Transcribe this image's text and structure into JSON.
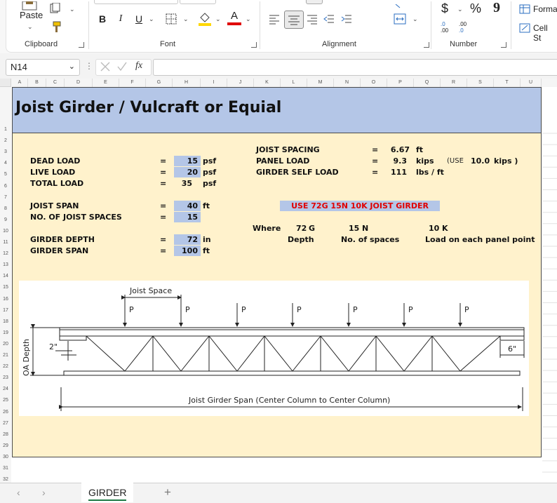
{
  "ribbon": {
    "clipboard": {
      "paste_label": "Paste",
      "group_label": "Clipboard"
    },
    "font": {
      "bold": "B",
      "italic": "I",
      "underline": "U",
      "font_color_letter": "A",
      "group_label": "Font",
      "font_color": "#e00000",
      "highlight_color": "#ffd700"
    },
    "alignment": {
      "group_label": "Alignment"
    },
    "number": {
      "currency": "$",
      "percent": "%",
      "comma": "9",
      "inc_decimal": ".0",
      "inc_decimal_b": ".00",
      "dec_decimal": ".00",
      "dec_decimal_b": ".0",
      "group_label": "Number"
    },
    "styles": {
      "format_label": "Forma",
      "cell_styles_label": "Cell St"
    }
  },
  "formula_bar": {
    "name_box": "N14",
    "fx": "fx",
    "formula": ""
  },
  "columns": [
    "A",
    "B",
    "C",
    "D",
    "E",
    "F",
    "G",
    "H",
    "I",
    "J",
    "K",
    "L",
    "M",
    "N",
    "O",
    "P",
    "Q",
    "R",
    "S",
    "T",
    "U"
  ],
  "rows": [
    "1",
    "2",
    "3",
    "4",
    "5",
    "6",
    "7",
    "8",
    "9",
    "10",
    "11",
    "12",
    "13",
    "14",
    "15",
    "16",
    "17",
    "18",
    "19",
    "20",
    "21",
    "22",
    "23",
    "24",
    "25",
    "26",
    "27",
    "28",
    "29",
    "30",
    "31",
    "32"
  ],
  "sheet": {
    "title": "Joist Girder / Vulcraft or Equial",
    "left": [
      {
        "label": "DEAD LOAD",
        "eq": "=",
        "value": "15",
        "unit": "psf",
        "input": true
      },
      {
        "label": "LIVE LOAD",
        "eq": "=",
        "value": "20",
        "unit": "psf",
        "input": true
      },
      {
        "label": "TOTAL LOAD",
        "eq": "=",
        "value": "35",
        "unit": "psf",
        "input": false
      },
      {
        "label": "JOIST SPAN",
        "eq": "=",
        "value": "40",
        "unit": "ft",
        "input": true
      },
      {
        "label": "NO. OF JOIST SPACES",
        "eq": "=",
        "value": "15",
        "unit": "",
        "input": true
      },
      {
        "label": "GIRDER DEPTH",
        "eq": "=",
        "value": "72",
        "unit": "in",
        "input": true
      },
      {
        "label": "GIRDER SPAN",
        "eq": "=",
        "value": "100",
        "unit": "ft",
        "input": true
      }
    ],
    "right": [
      {
        "label": "JOIST SPACING",
        "eq": "=",
        "value": "6.67",
        "unit": "ft"
      },
      {
        "label": "PANEL LOAD",
        "eq": "=",
        "value": "9.3",
        "unit": "kips"
      },
      {
        "label": "GIRDER SELF LOAD",
        "eq": "=",
        "value": "111",
        "unit": "lbs / ft"
      }
    ],
    "use_note": {
      "prefix": "(USE",
      "value": "10.0",
      "suffix": "kips )"
    },
    "use_text": "USE  72G 15N 10K  JOIST GIRDER",
    "where": {
      "label": "Where",
      "depth_val": "72",
      "depth_code": "G",
      "depth_label": "Depth",
      "spaces_val": "15",
      "spaces_code": "N",
      "spaces_label": "No. of spaces",
      "load_val": "10",
      "load_code": "K",
      "load_label": "Load on each panel point"
    },
    "diagram": {
      "joist_space": "Joist Space",
      "p_label": "P",
      "oa_depth": "OA Depth",
      "left_dim": "2\"",
      "right_dim": "6\"",
      "span_label": "Joist Girder Span (Center Column to Center Column)"
    }
  },
  "tabs": {
    "active": "GIRDER",
    "add": "+"
  }
}
